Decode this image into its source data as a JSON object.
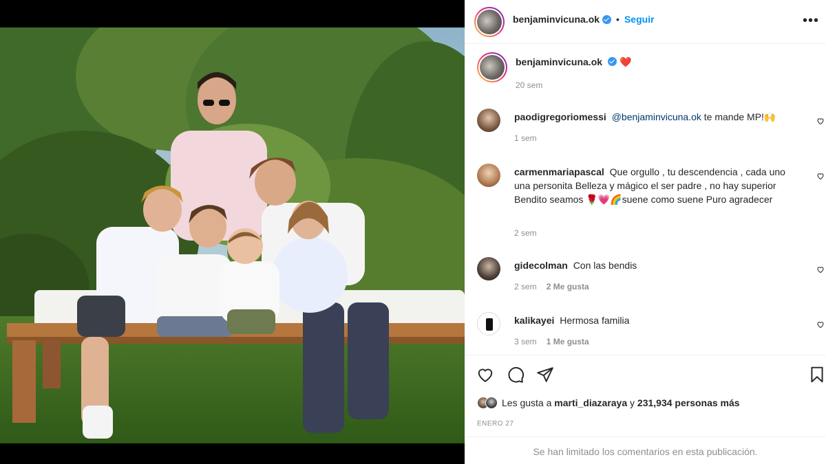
{
  "post": {
    "username": "benjaminvicuna.ok",
    "follow_label": "Seguir",
    "more_icon": "more-options-icon",
    "caption_emoji": "❤️",
    "caption_time": "20 sem",
    "photo_alt": "family-photo"
  },
  "comments": [
    {
      "username": "paodigregoriomessi",
      "mention": "@benjaminvicuna.ok",
      "text": " te mande MP!🙌",
      "time": "1 sem",
      "likes": ""
    },
    {
      "username": "carmenmariapascal",
      "mention": "",
      "text": "Que orgullo , tu descendencia , cada uno una personita Belleza y mágico el ser padre , no hay superior Bendito seamos 🌹💗🌈suene como suene Puro agradecer",
      "time": "2 sem",
      "likes": ""
    },
    {
      "username": "gidecolman",
      "mention": "",
      "text": "Con las bendis",
      "time": "2 sem",
      "likes": "2 Me gusta"
    },
    {
      "username": "kalikayei",
      "mention": "",
      "text": "Hermosa familia",
      "time": "3 sem",
      "likes": "1 Me gusta"
    }
  ],
  "likes": {
    "prefix": "Les gusta a",
    "user": "marti_diazaraya",
    "middle": "y",
    "count": "231,934 personas más"
  },
  "date": "ENERO 27",
  "limited_notice": "Se han limitado los comentarios en esta publicación.",
  "colors": {
    "accent": "#0095f6",
    "verified": "#3897f0",
    "muted": "#8e8e8e",
    "heart": "#ed4956"
  }
}
